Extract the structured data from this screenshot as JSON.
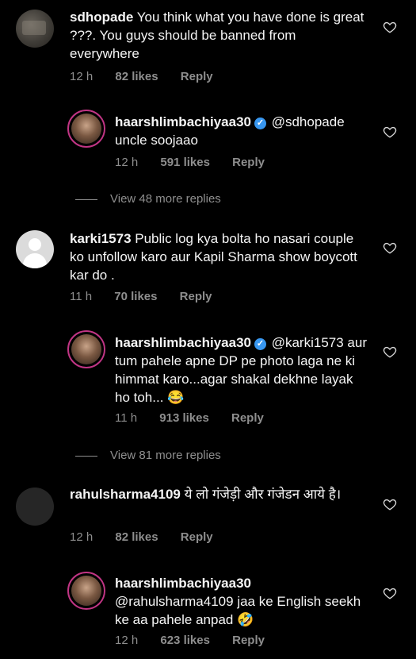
{
  "comments": [
    {
      "username": "sdhopade",
      "text": "You think what you have done is great ???. You guys should be banned from everywhere",
      "time": "12 h",
      "likes": "82 likes",
      "reply": "Reply"
    },
    {
      "username": "haarshlimbachiyaa30",
      "mention": "@sdhopade",
      "text": "uncle soojaao",
      "time": "12 h",
      "likes": "591 likes",
      "reply": "Reply"
    },
    {
      "username": "karki1573",
      "text": "Public log kya bolta ho  nasari couple ko unfollow karo aur Kapil Sharma show boycott kar do .",
      "time": "11 h",
      "likes": "70 likes",
      "reply": "Reply"
    },
    {
      "username": "haarshlimbachiyaa30",
      "mention": "@karki1573",
      "text": "aur tum pahele apne DP pe photo laga ne ki himmat karo...agar shakal dekhne layak ho toh... 😂",
      "time": "11 h",
      "likes": "913 likes",
      "reply": "Reply"
    },
    {
      "username": "rahulsharma4109",
      "text": "ये लो गंजेड़ी और गंजेडन आये है।",
      "time": "12 h",
      "likes": "82 likes",
      "reply": "Reply"
    },
    {
      "username": "haarshlimbachiyaa30",
      "mention": "@rahulsharma4109",
      "text": "jaa ke English seekh ke aa pahele anpad 🤣",
      "time": "12 h",
      "likes": "623 likes",
      "reply": "Reply"
    }
  ],
  "view_more": [
    "View 48 more replies",
    "View 81 more replies"
  ],
  "icons": {
    "like": "heart-outline-icon",
    "verified": "verified-badge-icon"
  },
  "colors": {
    "background": "#000000",
    "verified": "#3897f0",
    "muted": "#8e8e8e"
  }
}
